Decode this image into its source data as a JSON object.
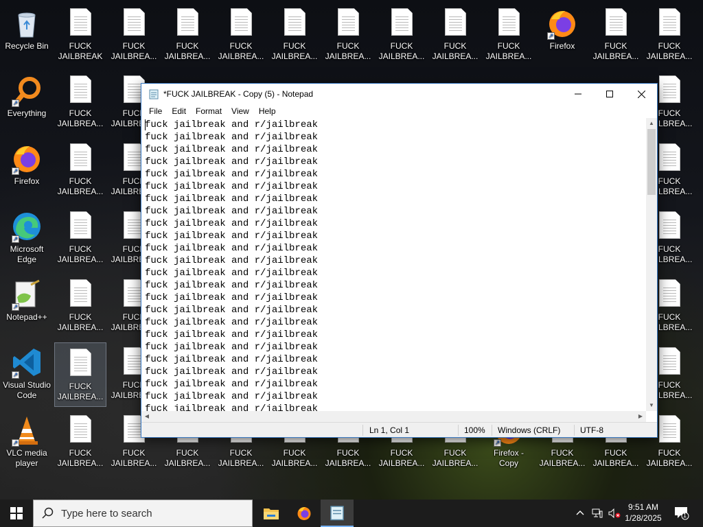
{
  "desktop": {
    "recycle_bin": "Recycle Bin",
    "everything": "Everything",
    "firefox": "Firefox",
    "edge": "Microsoft Edge",
    "notepadpp": "Notepad++",
    "vscode": "Visual Studio Code",
    "vlc": "VLC media player",
    "firefox_copy": "Firefox - Copy",
    "file_label_full": "FUCK JAILBREAK",
    "file_label_short": "FUCK JAILBREA..."
  },
  "notepad": {
    "title": "*FUCK JAILBREAK - Copy (5) - Notepad",
    "menu": [
      "File",
      "Edit",
      "Format",
      "View",
      "Help"
    ],
    "line_text": "fuck jailbreak and r/jailbreak",
    "status": {
      "position": "Ln 1, Col 1",
      "zoom": "100%",
      "line_ending": "Windows (CRLF)",
      "encoding": "UTF-8"
    }
  },
  "taskbar": {
    "search_placeholder": "Type here to search",
    "time": "9:51 AM",
    "date": "1/28/2025",
    "notification_count": "1"
  },
  "colors": {
    "accent": "#3a7ac4",
    "taskbar": "#1c1c1c",
    "active_underline": "#78b4ff"
  }
}
